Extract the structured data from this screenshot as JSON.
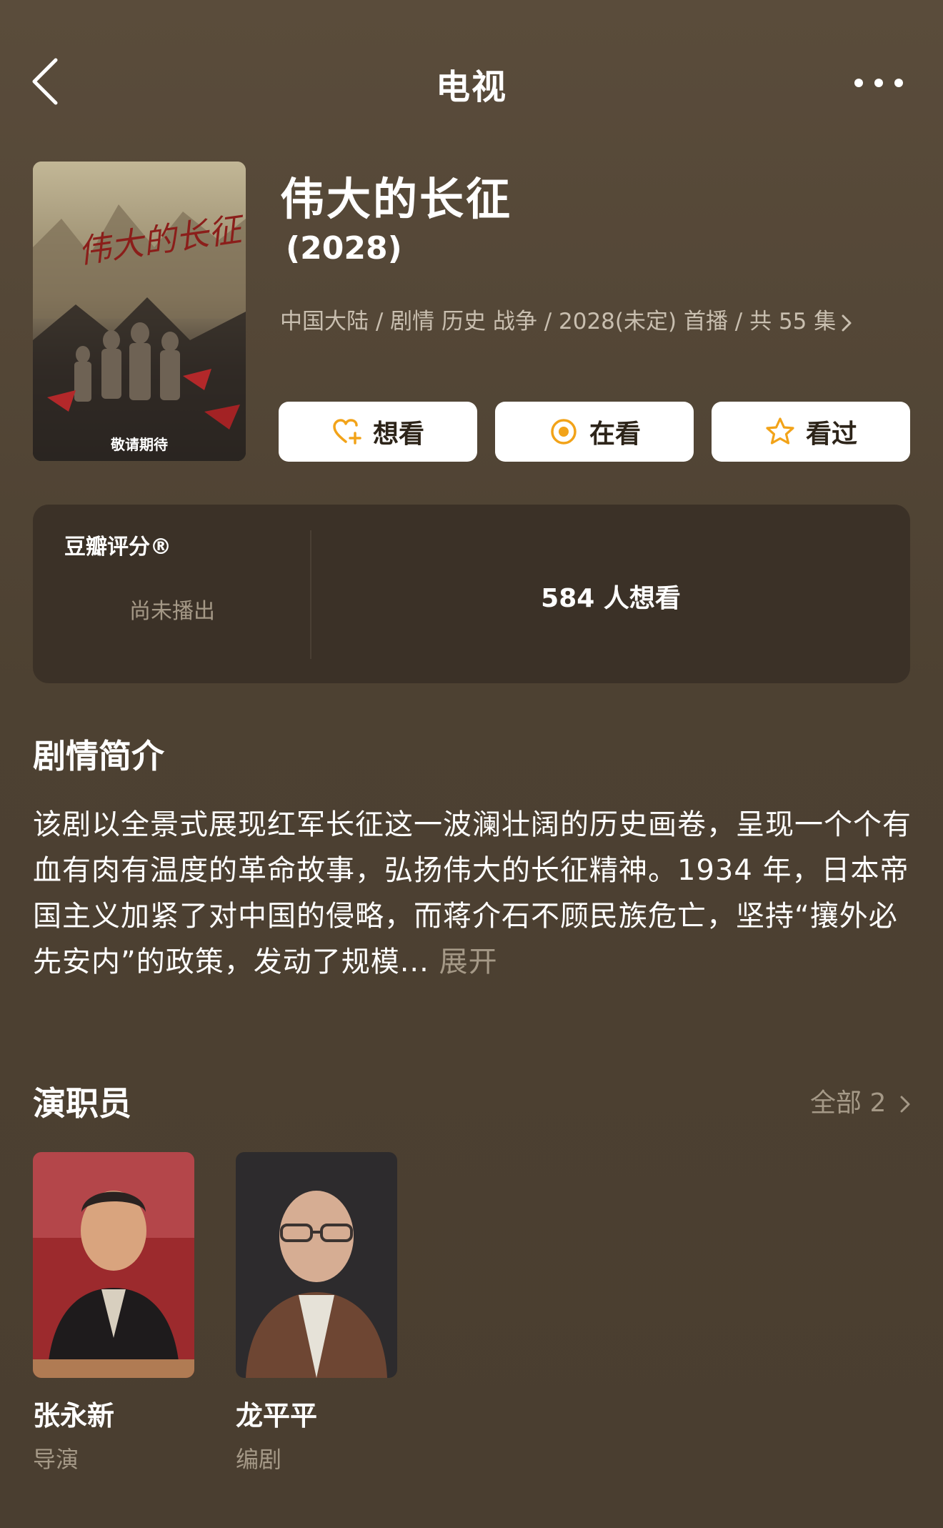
{
  "header": {
    "title": "电视"
  },
  "movie": {
    "title": "伟大的长征",
    "year": "(2028)",
    "meta": "中国大陆 / 剧情 历史 战争 / 2028(未定) 首播 / 共 55 集",
    "poster_caption": "敬请期待"
  },
  "actions": [
    {
      "label": "想看",
      "icon": "heart-plus-icon"
    },
    {
      "label": "在看",
      "icon": "target-circle-icon"
    },
    {
      "label": "看过",
      "icon": "star-icon"
    }
  ],
  "rating": {
    "label": "豆瓣评分®",
    "status": "尚未播出",
    "want_count": "584 人想看"
  },
  "synopsis": {
    "title": "剧情简介",
    "text": "该剧以全景式展现红军长征这一波澜壮阔的历史画卷，呈现一个个有血有肉有温度的革命故事，弘扬伟大的长征精神。1934 年，日本帝国主义加紧了对中国的侵略，而蒋介石不顾民族危亡，坚持“攘外必先安内”的政策，发动了规模...",
    "expand_label": "展开"
  },
  "cast": {
    "title": "演职员",
    "see_all": "全部 2",
    "members": [
      {
        "name": "张永新",
        "role": "导演"
      },
      {
        "name": "龙平平",
        "role": "编剧"
      }
    ]
  },
  "colors": {
    "background": "#4b3f30",
    "card": "#3b3127",
    "accent": "#f2a319",
    "muted_text": "#a59987"
  }
}
